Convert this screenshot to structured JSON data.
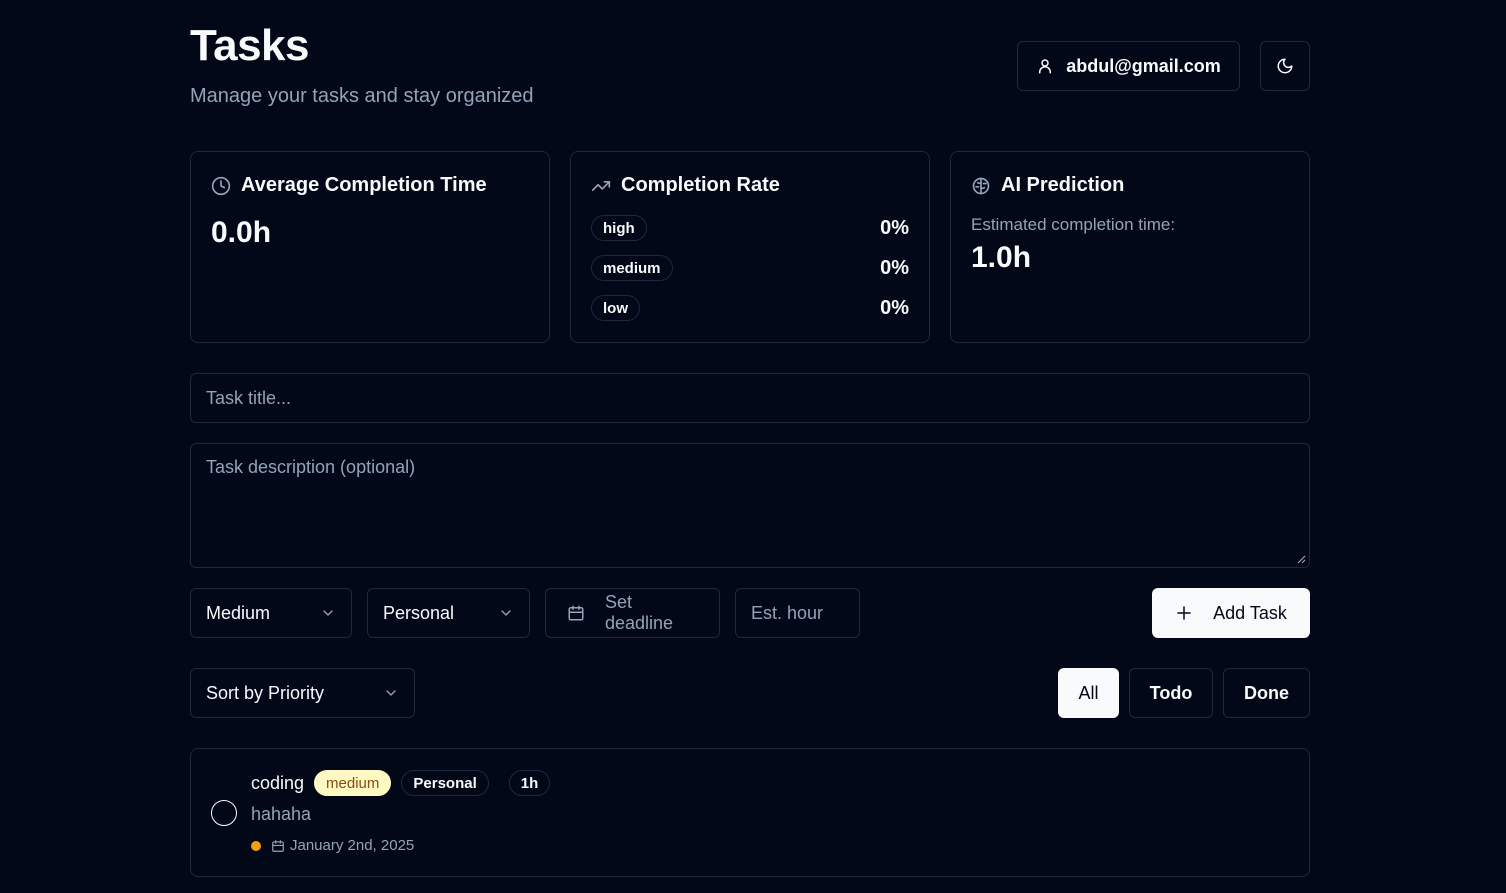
{
  "header": {
    "title": "Tasks",
    "subtitle": "Manage your tasks and stay organized",
    "user_email": "abdul@gmail.com",
    "user_icon": "user-icon",
    "theme_icon": "moon-icon"
  },
  "stats": {
    "avg_completion": {
      "icon": "clock-icon",
      "label": "Average Completion Time",
      "value": "0.0h"
    },
    "completion_rate": {
      "icon": "trending-up-icon",
      "label": "Completion Rate",
      "rows": [
        {
          "priority": "high",
          "value": "0%"
        },
        {
          "priority": "medium",
          "value": "0%"
        },
        {
          "priority": "low",
          "value": "0%"
        }
      ]
    },
    "ai_prediction": {
      "icon": "brain-icon",
      "label": "AI Prediction",
      "caption": "Estimated completion time:",
      "value": "1.0h"
    }
  },
  "form": {
    "title_placeholder": "Task title...",
    "description_placeholder": "Task description (optional)",
    "priority_value": "Medium",
    "category_value": "Personal",
    "deadline_placeholder": "Set deadline",
    "hours_placeholder": "Est. hour",
    "add_label": "Add Task"
  },
  "toolbar": {
    "sort_value": "Sort by Priority",
    "filters": [
      "All",
      "Todo",
      "Done"
    ],
    "active_filter": "All"
  },
  "tasks": [
    {
      "title": "coding",
      "priority": "medium",
      "category": "Personal",
      "hours": "1h",
      "description": "hahaha",
      "deadline": "January 2nd, 2025",
      "done": false
    }
  ],
  "colors": {
    "background": "#020817",
    "border": "#1e293b",
    "muted_text": "#94a3b8",
    "medium_badge_bg": "#fef9c3",
    "medium_badge_text": "#854d0e",
    "medium_dot": "#f59e0b"
  }
}
